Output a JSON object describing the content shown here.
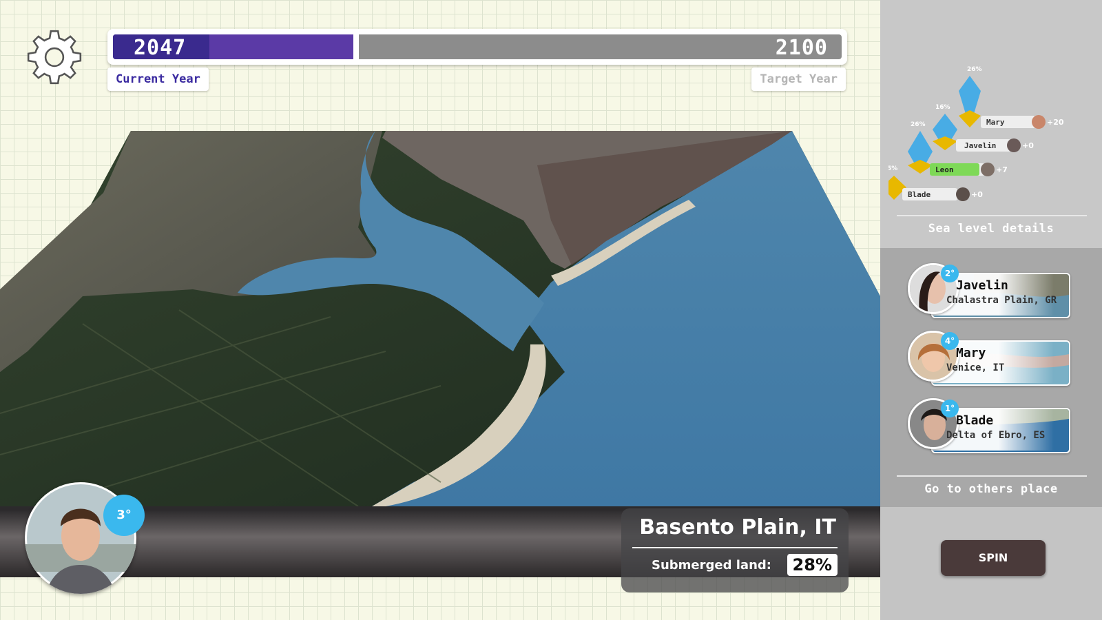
{
  "settings": {
    "icon": "gear-icon"
  },
  "year": {
    "current": "2047",
    "target": "2100",
    "current_label": "Current Year",
    "target_label": "Target Year",
    "progress_fraction": 0.33
  },
  "location": {
    "name": "Basento Plain, IT",
    "submerged_label": "Submerged land:",
    "submerged_value": "28%"
  },
  "player": {
    "badge": "3°"
  },
  "sea_level": {
    "caption": "Sea level details",
    "entries": [
      {
        "pct": "26%",
        "name": "Mary",
        "delta": "+20",
        "color": "#3aa8e8"
      },
      {
        "pct": "16%",
        "name": "Javelin",
        "delta": "+0",
        "color": "#3aa8e8"
      },
      {
        "pct": "26%",
        "name": "Leon",
        "delta": "+7",
        "color": "#3aa8e8"
      },
      {
        "pct": "5%",
        "name": "Blade",
        "delta": "+0",
        "color": "#e8b800"
      }
    ]
  },
  "others": {
    "caption": "Go to others place",
    "cards": [
      {
        "badge": "2°",
        "name": "Javelin",
        "location": "Chalastra Plain, GR"
      },
      {
        "badge": "4°",
        "name": "Mary",
        "location": "Venice, IT"
      },
      {
        "badge": "1°",
        "name": "Blade",
        "location": "Delta of Ebro, ES"
      }
    ]
  },
  "spin": {
    "label": "SPIN"
  }
}
